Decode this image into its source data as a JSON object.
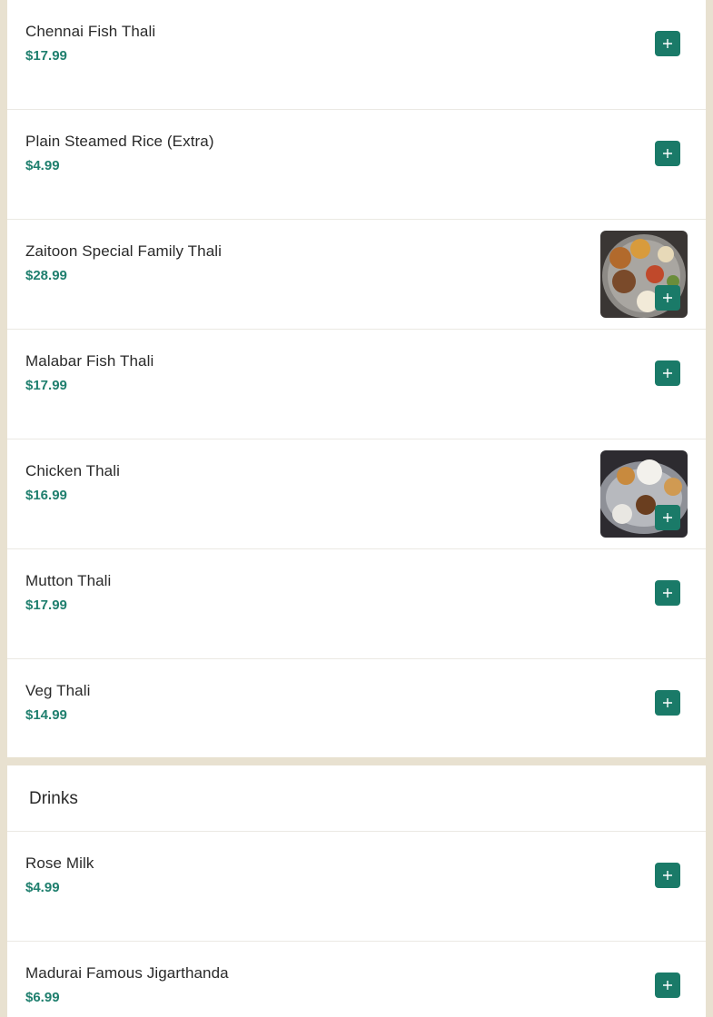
{
  "thali_items": [
    {
      "name": "Chennai Fish Thali",
      "price": "$17.99"
    },
    {
      "name": "Plain Steamed Rice (Extra)",
      "price": "$4.99"
    },
    {
      "name": "Zaitoon Special Family Thali",
      "price": "$28.99"
    },
    {
      "name": "Malabar Fish Thali",
      "price": "$17.99"
    },
    {
      "name": "Chicken Thali",
      "price": "$16.99"
    },
    {
      "name": "Mutton Thali",
      "price": "$17.99"
    },
    {
      "name": "Veg Thali",
      "price": "$14.99"
    }
  ],
  "drinks": {
    "title": "Drinks",
    "items": [
      {
        "name": "Rose Milk",
        "price": "$4.99"
      },
      {
        "name": "Madurai Famous Jigarthanda",
        "price": "$6.99"
      }
    ]
  },
  "icons": {
    "add": "plus-icon"
  },
  "colors": {
    "accent": "#1a7a68",
    "price": "#1f7f6e",
    "background": "#e8e1d0"
  }
}
